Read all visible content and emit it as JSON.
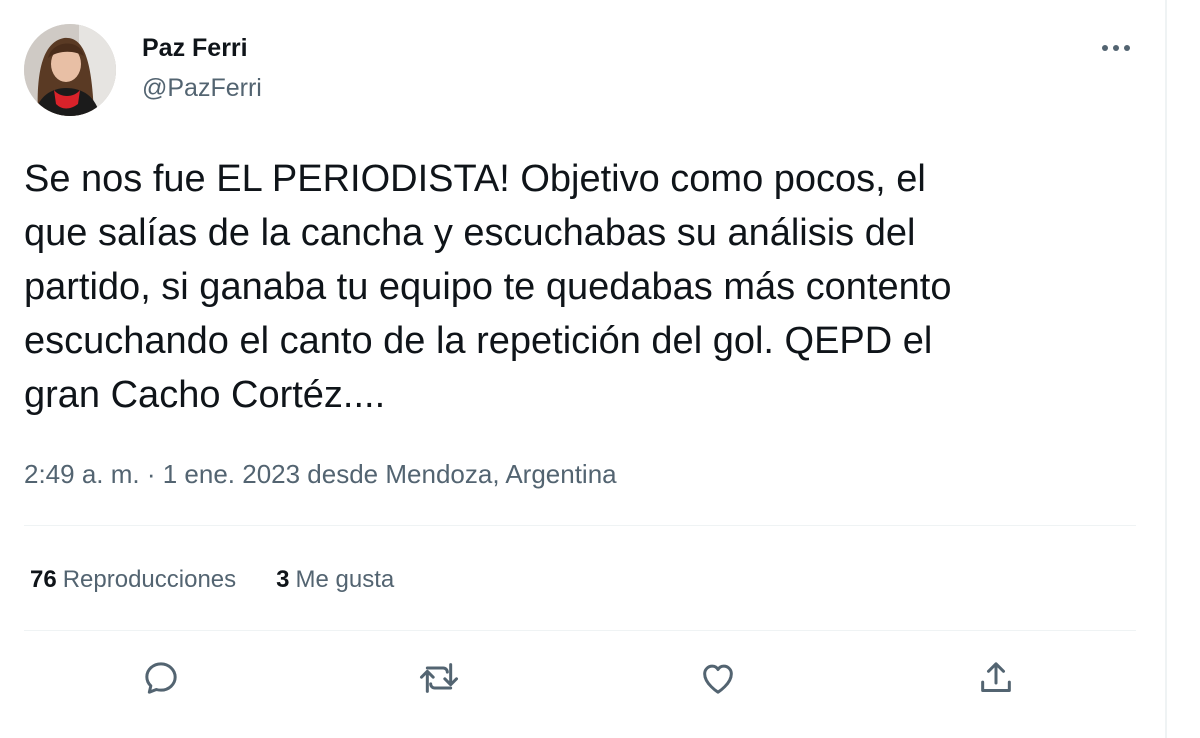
{
  "tweet": {
    "display_name": "Paz Ferri",
    "handle": "@PazFerri",
    "text": "Se nos fue EL PERIODISTA! Objetivo como pocos, el\nque salías de la cancha y escuchabas su análisis del\npartido, si ganaba tu equipo te quedabas más contento\nescuchando el canto de la repetición del gol. QEPD el\ngran Cacho Cortéz....",
    "timestamp": "2:49 a. m. · 1 ene. 2023 desde Mendoza, Argentina"
  },
  "stats": {
    "views_count": "76",
    "views_label": "Reproducciones",
    "likes_count": "3",
    "likes_label": "Me gusta"
  },
  "icons": {
    "more": "more-horizontal-icon",
    "reply": "reply-icon",
    "retweet": "retweet-icon",
    "like": "heart-icon",
    "share": "share-icon"
  },
  "colors": {
    "text_primary": "#0f1419",
    "text_secondary": "#536471",
    "divider": "#eff3f4"
  }
}
